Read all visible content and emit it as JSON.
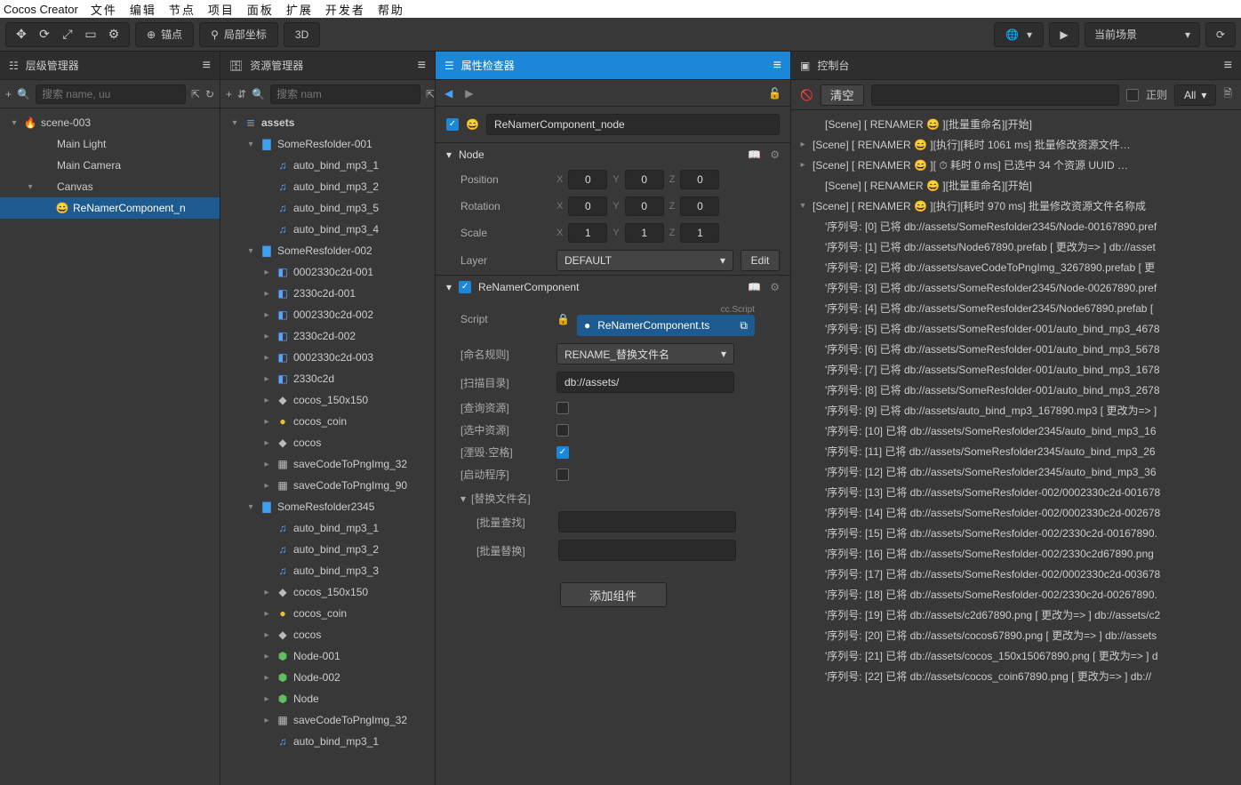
{
  "os_menu": {
    "brand": "Cocos Creator",
    "items": [
      "文件",
      "编辑",
      "节点",
      "项目",
      "面板",
      "扩展",
      "开发者",
      "帮助"
    ]
  },
  "toolbar": {
    "anchor_label": "锚点",
    "local_label": "局部坐标",
    "view_label": "3D",
    "scene_dropdown": "当前场景",
    "icons": {
      "move": "✥",
      "reload": "⟳",
      "expand": "⤢",
      "focus": "▭",
      "gear": "⚙",
      "anchor": "⊕",
      "globe": "⚲",
      "net": "🌐",
      "play": "▶",
      "reload2": "⟳"
    }
  },
  "panels": {
    "hierarchy": {
      "title": "层级管理器",
      "search_placeholder": "搜索 name, uu"
    },
    "assets": {
      "title": "资源管理器",
      "search_placeholder": "搜索 nam"
    },
    "inspector": {
      "title": "属性检查器"
    },
    "console": {
      "title": "控制台",
      "clear": "清空",
      "regex": "正则",
      "all": "All"
    }
  },
  "hierarchy_tree": [
    {
      "indent": 0,
      "arrow": "▾",
      "icon": "flame",
      "glyph": "🔥",
      "label": "scene-003"
    },
    {
      "indent": 1,
      "arrow": "",
      "icon": "",
      "glyph": "",
      "label": "Main Light"
    },
    {
      "indent": 1,
      "arrow": "",
      "icon": "",
      "glyph": "",
      "label": "Main Camera"
    },
    {
      "indent": 1,
      "arrow": "▾",
      "icon": "",
      "glyph": "",
      "label": "Canvas"
    },
    {
      "indent": 2,
      "arrow": "",
      "icon": "smile",
      "glyph": "😄",
      "label": "ReNamerComponent_n",
      "sel": true
    }
  ],
  "asset_tree": [
    {
      "indent": 0,
      "arrow": "▾",
      "icon": "folder",
      "glyph": "≣",
      "label": "assets",
      "bold": true
    },
    {
      "indent": 1,
      "arrow": "▾",
      "icon": "folder",
      "glyph": "▇",
      "label": "SomeResfolder-001"
    },
    {
      "indent": 2,
      "arrow": "",
      "icon": "audio",
      "glyph": "♫",
      "label": "auto_bind_mp3_1"
    },
    {
      "indent": 2,
      "arrow": "",
      "icon": "audio",
      "glyph": "♫",
      "label": "auto_bind_mp3_2"
    },
    {
      "indent": 2,
      "arrow": "",
      "icon": "audio",
      "glyph": "♫",
      "label": "auto_bind_mp3_5"
    },
    {
      "indent": 2,
      "arrow": "",
      "icon": "audio",
      "glyph": "♫",
      "label": "auto_bind_mp3_4"
    },
    {
      "indent": 1,
      "arrow": "▾",
      "icon": "folder",
      "glyph": "▇",
      "label": "SomeResfolder-002"
    },
    {
      "indent": 2,
      "arrow": "▸",
      "icon": "prefab",
      "glyph": "◧",
      "label": "0002330c2d-001"
    },
    {
      "indent": 2,
      "arrow": "▸",
      "icon": "prefab",
      "glyph": "◧",
      "label": "2330c2d-001"
    },
    {
      "indent": 2,
      "arrow": "▸",
      "icon": "prefab",
      "glyph": "◧",
      "label": "0002330c2d-002"
    },
    {
      "indent": 2,
      "arrow": "▸",
      "icon": "prefab",
      "glyph": "◧",
      "label": "2330c2d-002"
    },
    {
      "indent": 2,
      "arrow": "▸",
      "icon": "prefab",
      "glyph": "◧",
      "label": "0002330c2d-003"
    },
    {
      "indent": 2,
      "arrow": "▸",
      "icon": "prefab",
      "glyph": "◧",
      "label": "2330c2d"
    },
    {
      "indent": 2,
      "arrow": "▸",
      "icon": "img",
      "glyph": "◆",
      "label": "cocos_150x150"
    },
    {
      "indent": 2,
      "arrow": "▸",
      "icon": "coin",
      "glyph": "●",
      "label": "cocos_coin"
    },
    {
      "indent": 2,
      "arrow": "▸",
      "icon": "cocos",
      "glyph": "◆",
      "label": "cocos"
    },
    {
      "indent": 2,
      "arrow": "▸",
      "icon": "img",
      "glyph": "▦",
      "label": "saveCodeToPngImg_32"
    },
    {
      "indent": 2,
      "arrow": "▸",
      "icon": "img",
      "glyph": "▦",
      "label": "saveCodeToPngImg_90"
    },
    {
      "indent": 1,
      "arrow": "▾",
      "icon": "folder",
      "glyph": "▇",
      "label": "SomeResfolder2345"
    },
    {
      "indent": 2,
      "arrow": "",
      "icon": "audio",
      "glyph": "♫",
      "label": "auto_bind_mp3_1"
    },
    {
      "indent": 2,
      "arrow": "",
      "icon": "audio",
      "glyph": "♫",
      "label": "auto_bind_mp3_2"
    },
    {
      "indent": 2,
      "arrow": "",
      "icon": "audio",
      "glyph": "♫",
      "label": "auto_bind_mp3_3"
    },
    {
      "indent": 2,
      "arrow": "▸",
      "icon": "img",
      "glyph": "◆",
      "label": "cocos_150x150"
    },
    {
      "indent": 2,
      "arrow": "▸",
      "icon": "coin",
      "glyph": "●",
      "label": "cocos_coin"
    },
    {
      "indent": 2,
      "arrow": "▸",
      "icon": "cocos",
      "glyph": "◆",
      "label": "cocos"
    },
    {
      "indent": 2,
      "arrow": "▸",
      "icon": "green",
      "glyph": "⬢",
      "label": "Node-001"
    },
    {
      "indent": 2,
      "arrow": "▸",
      "icon": "green",
      "glyph": "⬢",
      "label": "Node-002"
    },
    {
      "indent": 2,
      "arrow": "▸",
      "icon": "green",
      "glyph": "⬢",
      "label": "Node"
    },
    {
      "indent": 2,
      "arrow": "▸",
      "icon": "img",
      "glyph": "▦",
      "label": "saveCodeToPngImg_32"
    },
    {
      "indent": 2,
      "arrow": "",
      "icon": "audio",
      "glyph": "♫",
      "label": "auto_bind_mp3_1"
    }
  ],
  "inspector": {
    "node_name": "ReNamerComponent_node",
    "node_section": "Node",
    "fields": {
      "position": "Position",
      "rotation": "Rotation",
      "scale": "Scale",
      "layer": "Layer",
      "pos": {
        "x": "0",
        "y": "0",
        "z": "0"
      },
      "rot": {
        "x": "0",
        "y": "0",
        "z": "0"
      },
      "scl": {
        "x": "1",
        "y": "1",
        "z": "1"
      },
      "layer_val": "DEFAULT",
      "edit": "Edit"
    },
    "component_name": "ReNamerComponent",
    "script_label": "Script",
    "script_hint": "cc.Script",
    "script_val": "ReNamerComponent.ts",
    "rule_label": "[命名规则]",
    "rule_val": "RENAME_替换文件名",
    "scan_label": "[扫描目录]",
    "scan_val": "db://assets/",
    "query_label": "[查询资源]",
    "query_val": false,
    "select_label": "[选中资源]",
    "select_val": false,
    "trim_label": "[湮毁·空格]",
    "trim_val": true,
    "start_label": "[启动程序]",
    "start_val": false,
    "replace_section": "[替换文件名]",
    "batch_find": "[批量查找]",
    "batch_replace": "[批量替换]",
    "add_component": "添加组件",
    "ax": {
      "x": "X",
      "y": "Y",
      "z": "Z"
    }
  },
  "console_logs": [
    {
      "arrow": "",
      "text": "[Scene] [ RENAMER 😄 ][批量重命名][开始]"
    },
    {
      "arrow": "▸",
      "text": "[Scene] [ RENAMER 😄 ][执行][耗时 1061 ms] 批量修改资源文件…"
    },
    {
      "arrow": "▸",
      "text": "[Scene] [ RENAMER 😄 ][ ⏱ 耗时 0 ms] 已选中 34 个资源 UUID …"
    },
    {
      "arrow": "",
      "text": "[Scene] [ RENAMER 😄 ][批量重命名][开始]"
    },
    {
      "arrow": "▾",
      "text": "[Scene] [ RENAMER 😄 ][执行][耗时 970 ms] 批量修改资源文件名称成"
    },
    {
      "arrow": "",
      "text": "'序列号: [0] 已将 db://assets/SomeResfolder2345/Node-00167890.pref"
    },
    {
      "arrow": "",
      "text": "'序列号: [1] 已将 db://assets/Node67890.prefab [ 更改为=> ] db://asset"
    },
    {
      "arrow": "",
      "text": "'序列号: [2] 已将 db://assets/saveCodeToPngImg_3267890.prefab [ 更"
    },
    {
      "arrow": "",
      "text": "'序列号: [3] 已将 db://assets/SomeResfolder2345/Node-00267890.pref"
    },
    {
      "arrow": "",
      "text": "'序列号: [4] 已将 db://assets/SomeResfolder2345/Node67890.prefab ["
    },
    {
      "arrow": "",
      "text": "'序列号: [5] 已将 db://assets/SomeResfolder-001/auto_bind_mp3_4678"
    },
    {
      "arrow": "",
      "text": "'序列号: [6] 已将 db://assets/SomeResfolder-001/auto_bind_mp3_5678"
    },
    {
      "arrow": "",
      "text": "'序列号: [7] 已将 db://assets/SomeResfolder-001/auto_bind_mp3_1678"
    },
    {
      "arrow": "",
      "text": "'序列号: [8] 已将 db://assets/SomeResfolder-001/auto_bind_mp3_2678"
    },
    {
      "arrow": "",
      "text": "'序列号: [9] 已将 db://assets/auto_bind_mp3_167890.mp3 [ 更改为=> ]"
    },
    {
      "arrow": "",
      "text": "'序列号: [10] 已将 db://assets/SomeResfolder2345/auto_bind_mp3_16"
    },
    {
      "arrow": "",
      "text": "'序列号: [11] 已将 db://assets/SomeResfolder2345/auto_bind_mp3_26"
    },
    {
      "arrow": "",
      "text": "'序列号: [12] 已将 db://assets/SomeResfolder2345/auto_bind_mp3_36"
    },
    {
      "arrow": "",
      "text": "'序列号: [13] 已将 db://assets/SomeResfolder-002/0002330c2d-001678"
    },
    {
      "arrow": "",
      "text": "'序列号: [14] 已将 db://assets/SomeResfolder-002/0002330c2d-002678"
    },
    {
      "arrow": "",
      "text": "'序列号: [15] 已将 db://assets/SomeResfolder-002/2330c2d-00167890."
    },
    {
      "arrow": "",
      "text": "'序列号: [16] 已将 db://assets/SomeResfolder-002/2330c2d67890.png"
    },
    {
      "arrow": "",
      "text": "'序列号: [17] 已将 db://assets/SomeResfolder-002/0002330c2d-003678"
    },
    {
      "arrow": "",
      "text": "'序列号: [18] 已将 db://assets/SomeResfolder-002/2330c2d-00267890."
    },
    {
      "arrow": "",
      "text": "'序列号: [19] 已将 db://assets/c2d67890.png [ 更改为=> ] db://assets/c2"
    },
    {
      "arrow": "",
      "text": "'序列号: [20] 已将 db://assets/cocos67890.png [ 更改为=> ] db://assets"
    },
    {
      "arrow": "",
      "text": "'序列号: [21] 已将 db://assets/cocos_150x15067890.png [ 更改为=> ] d"
    },
    {
      "arrow": "",
      "text": "'序列号: [22] 已将 db://assets/cocos_coin67890.png [ 更改为=> ] db://"
    }
  ]
}
